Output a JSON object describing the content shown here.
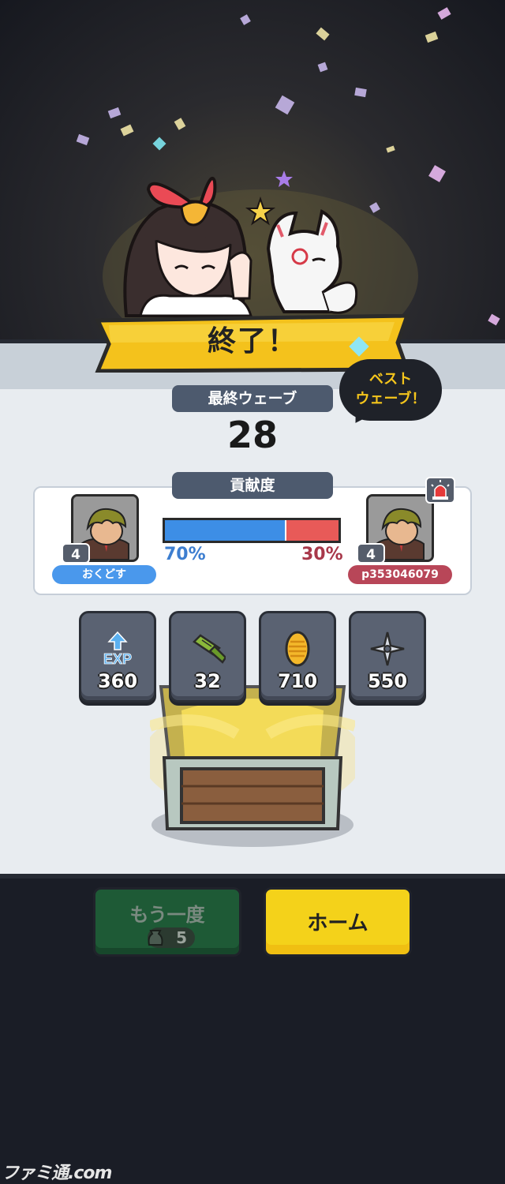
{
  "banner": {
    "title": "終了！"
  },
  "wave": {
    "label": "最終ウェーブ",
    "value": "28",
    "best_badge": "ベスト\nウェーブ！"
  },
  "contribution": {
    "label": "貢献度",
    "player_left": {
      "name": "おくどす",
      "level": "4",
      "percent": "70%",
      "share": 0.7,
      "color": "#4a98ec"
    },
    "player_right": {
      "name": "p353046079",
      "level": "4",
      "percent": "30%",
      "share": 0.3,
      "color": "#b84658"
    }
  },
  "rewards": [
    {
      "icon": "exp-icon",
      "label": "EXP",
      "value": "360"
    },
    {
      "icon": "bamboo-scroll-icon",
      "value": "32"
    },
    {
      "icon": "gold-koban-icon",
      "value": "710"
    },
    {
      "icon": "shuriken-icon",
      "value": "550"
    }
  ],
  "buttons": {
    "retry_label": "もう一度",
    "retry_cost": "5",
    "home_label": "ホーム"
  },
  "watermark": "ファミ通.com",
  "colors": {
    "banner": "#f4c21c",
    "panel": "#e8ecf0",
    "bar_left": "#3d8ee6",
    "bar_right": "#e85a58"
  }
}
